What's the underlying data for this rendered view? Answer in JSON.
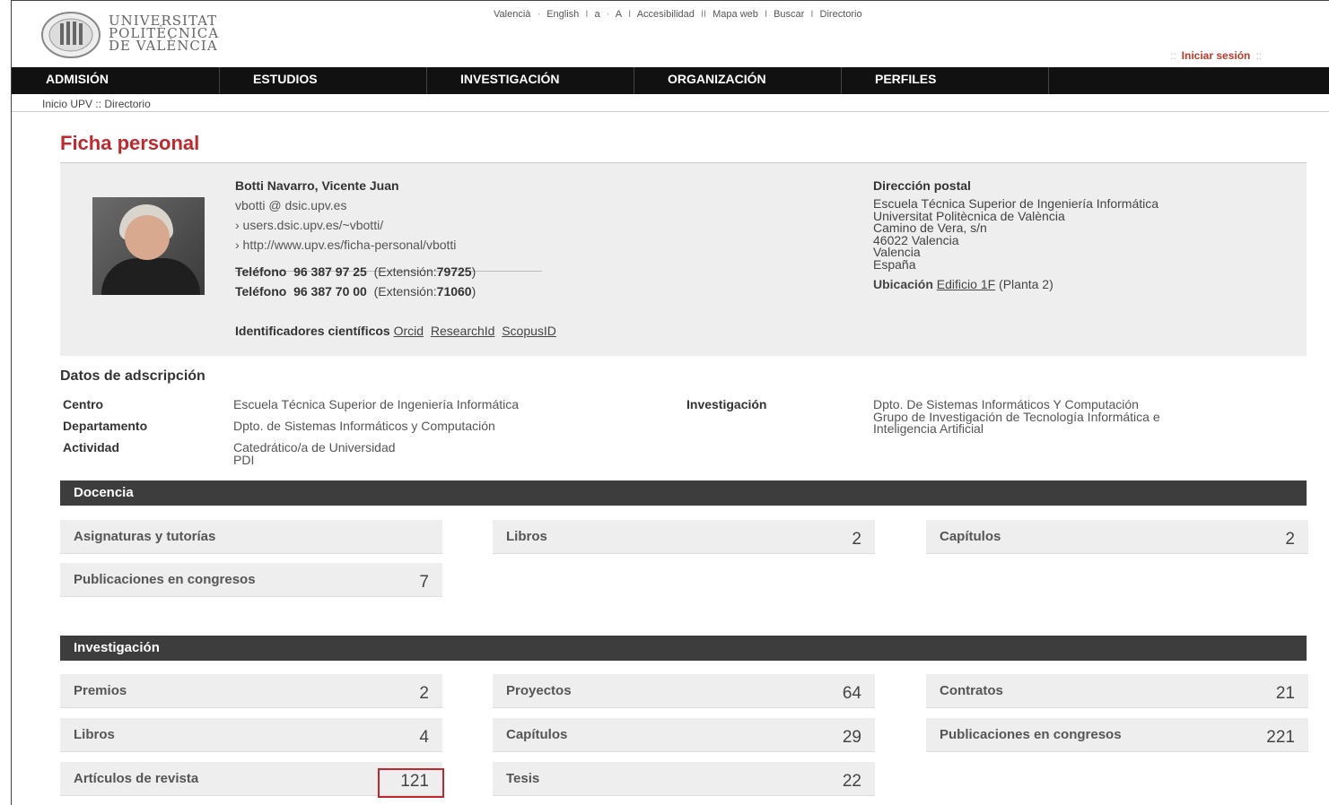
{
  "header": {
    "logo_lines": [
      "UNIVERSITAT",
      "POLITÈCNICA",
      "DE VALÈNCIA"
    ],
    "toplinks": [
      "Valencià",
      "·",
      "English",
      "I",
      "a",
      "·",
      "A",
      "I",
      "Accesibilidad",
      "II",
      "Mapa web",
      "I",
      "Buscar",
      "I",
      "Directorio"
    ],
    "login_prefix": "::",
    "login_label": "Iniciar sesión",
    "login_suffix": "::"
  },
  "nav": [
    "ADMISIÓN",
    "ESTUDIOS",
    "INVESTIGACIÓN",
    "ORGANIZACIÓN",
    "PERFILES"
  ],
  "breadcrumb": {
    "home": "Inicio UPV",
    "sep": "::",
    "current": "Directorio"
  },
  "page_title": "Ficha personal",
  "person": {
    "name": "Botti Navarro, Vicente Juan",
    "email": "vbotti @ dsic.upv.es",
    "link1": "› users.dsic.upv.es/~vbotti/",
    "link2": "› http://www.upv.es/ficha-personal/vbotti",
    "phones": [
      {
        "label": "Teléfono",
        "number": "96 387 97 25",
        "ext_prefix": "(Extensión:",
        "ext": "79725",
        "ext_suffix": ")"
      },
      {
        "label": "Teléfono",
        "number": "96 387 70 00",
        "ext_prefix": "(Extensión:",
        "ext": "71060",
        "ext_suffix": ")"
      }
    ],
    "ids_label": "Identificadores científicos",
    "ids": [
      "Orcid",
      "ResearchId",
      "ScopusID"
    ]
  },
  "address": {
    "heading": "Dirección postal",
    "lines": [
      "Escuela Técnica Superior de Ingeniería Informática",
      "Universitat Politècnica de València",
      "Camino de Vera, s/n",
      "46022 Valencia",
      "Valencia",
      "España"
    ],
    "ubic_label": "Ubicación",
    "ubic_link": "Edificio 1F",
    "ubic_extra": "(Planta 2)"
  },
  "adscripcion": {
    "title": "Datos de adscripción",
    "centro_label": "Centro",
    "centro": "Escuela Técnica Superior de Ingeniería Informática",
    "depto_label": "Departamento",
    "depto": "Dpto. de Sistemas Informáticos y Computación",
    "actividad_label": "Actividad",
    "actividad": [
      "Catedrático/a de Universidad",
      "PDI"
    ],
    "invest_label": "Investigación",
    "invest": [
      "Dpto. De Sistemas Informáticos Y Computación",
      "Grupo de Investigación de Tecnología Informática e",
      "Inteligencia Artificial"
    ]
  },
  "docencia": {
    "title": "Docencia",
    "cards": [
      {
        "label": "Asignaturas y tutorías",
        "value": ""
      },
      {
        "label": "Libros",
        "value": "2"
      },
      {
        "label": "Capítulos",
        "value": "2"
      },
      {
        "label": "Publicaciones en congresos",
        "value": "7"
      }
    ]
  },
  "investigacion": {
    "title": "Investigación",
    "cards": [
      {
        "label": "Premios",
        "value": "2"
      },
      {
        "label": "Proyectos",
        "value": "64"
      },
      {
        "label": "Contratos",
        "value": "21"
      },
      {
        "label": "Libros",
        "value": "4"
      },
      {
        "label": "Capítulos",
        "value": "29"
      },
      {
        "label": "Publicaciones en congresos",
        "value": "221"
      },
      {
        "label": "Artículos de revista",
        "value": "121"
      },
      {
        "label": "Tesis",
        "value": "22"
      }
    ]
  },
  "colors": {
    "accent": "#c0282d",
    "nav_bg": "#111111",
    "bar_bg": "#3d3d3d",
    "card_bg": "#eeeeee"
  }
}
